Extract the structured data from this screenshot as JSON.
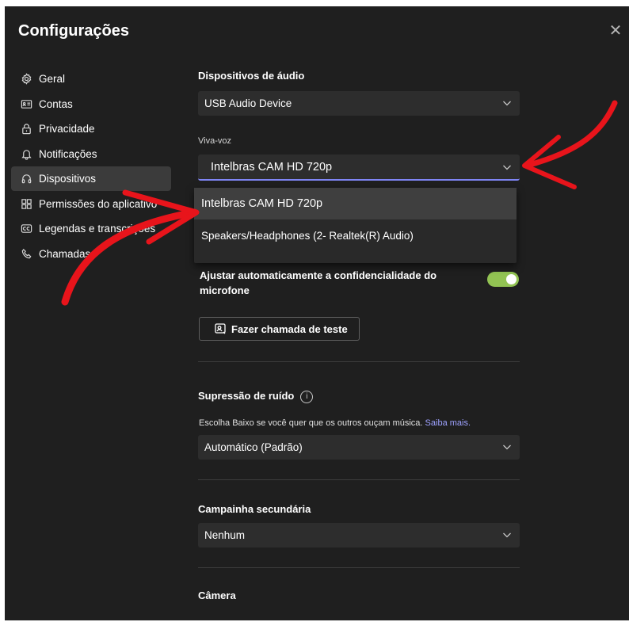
{
  "window": {
    "title": "Configurações"
  },
  "sidebar": {
    "items": [
      {
        "label": "Geral",
        "icon": "gear-icon"
      },
      {
        "label": "Contas",
        "icon": "id-card-icon"
      },
      {
        "label": "Privacidade",
        "icon": "lock-icon"
      },
      {
        "label": "Notificações",
        "icon": "bell-icon"
      },
      {
        "label": "Dispositivos",
        "icon": "headset-icon",
        "active": true
      },
      {
        "label": "Permissões do aplicativo",
        "icon": "apps-icon"
      },
      {
        "label": "Legendas e transcrições",
        "icon": "captions-icon"
      },
      {
        "label": "Chamadas",
        "icon": "phone-icon"
      }
    ]
  },
  "audio": {
    "heading": "Dispositivos de áudio",
    "device_value": "USB Audio Device",
    "speaker_label": "Viva-voz",
    "speaker_value": "Intelbras CAM HD 720p",
    "speaker_options": [
      "Intelbras CAM HD 720p",
      "Speakers/Headphones (2- Realtek(R) Audio)"
    ],
    "auto_adjust_label": "Ajustar automaticamente a confidencialidade do microfone",
    "auto_adjust_on": true,
    "test_call_label": "Fazer chamada de teste"
  },
  "noise": {
    "heading": "Supressão de ruído",
    "info_icon": "info-icon",
    "desc": "Escolha Baixo se você quer que os outros ouçam música.",
    "link": "Saiba mais.",
    "value": "Automático (Padrão)"
  },
  "secondary_ringer": {
    "heading": "Campainha secundária",
    "value": "Nenhum"
  },
  "camera": {
    "heading": "Câmera"
  },
  "colors": {
    "accent": "#7f85f5",
    "toggle_on": "#92c353",
    "annotation": "#e8141b",
    "background": "#1f1f1f"
  }
}
